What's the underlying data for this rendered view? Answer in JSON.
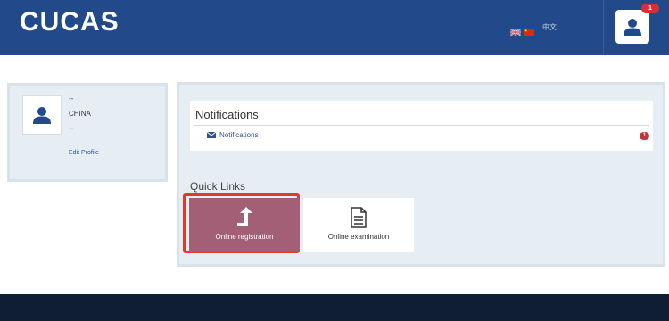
{
  "header": {
    "logo": "CUCAS",
    "lang_chinese": "中文",
    "notification_count": "1",
    "colors": {
      "header_bg": "#224a8b",
      "badge": "#d32f3c"
    }
  },
  "profile": {
    "line1": "--",
    "country": "CHINA",
    "line3": "--",
    "edit_label": "Edit Profile"
  },
  "notifications": {
    "title": "Notifications",
    "link_label": "Notifications",
    "count": "1"
  },
  "quick_links": {
    "title": "Quick Links",
    "items": [
      {
        "label": "Online registration",
        "icon": "upload-arrow-icon",
        "color": "#a25f76"
      },
      {
        "label": "Online examination",
        "icon": "document-icon",
        "color": "#ffffff"
      }
    ],
    "highlight_color": "#e2382a"
  }
}
